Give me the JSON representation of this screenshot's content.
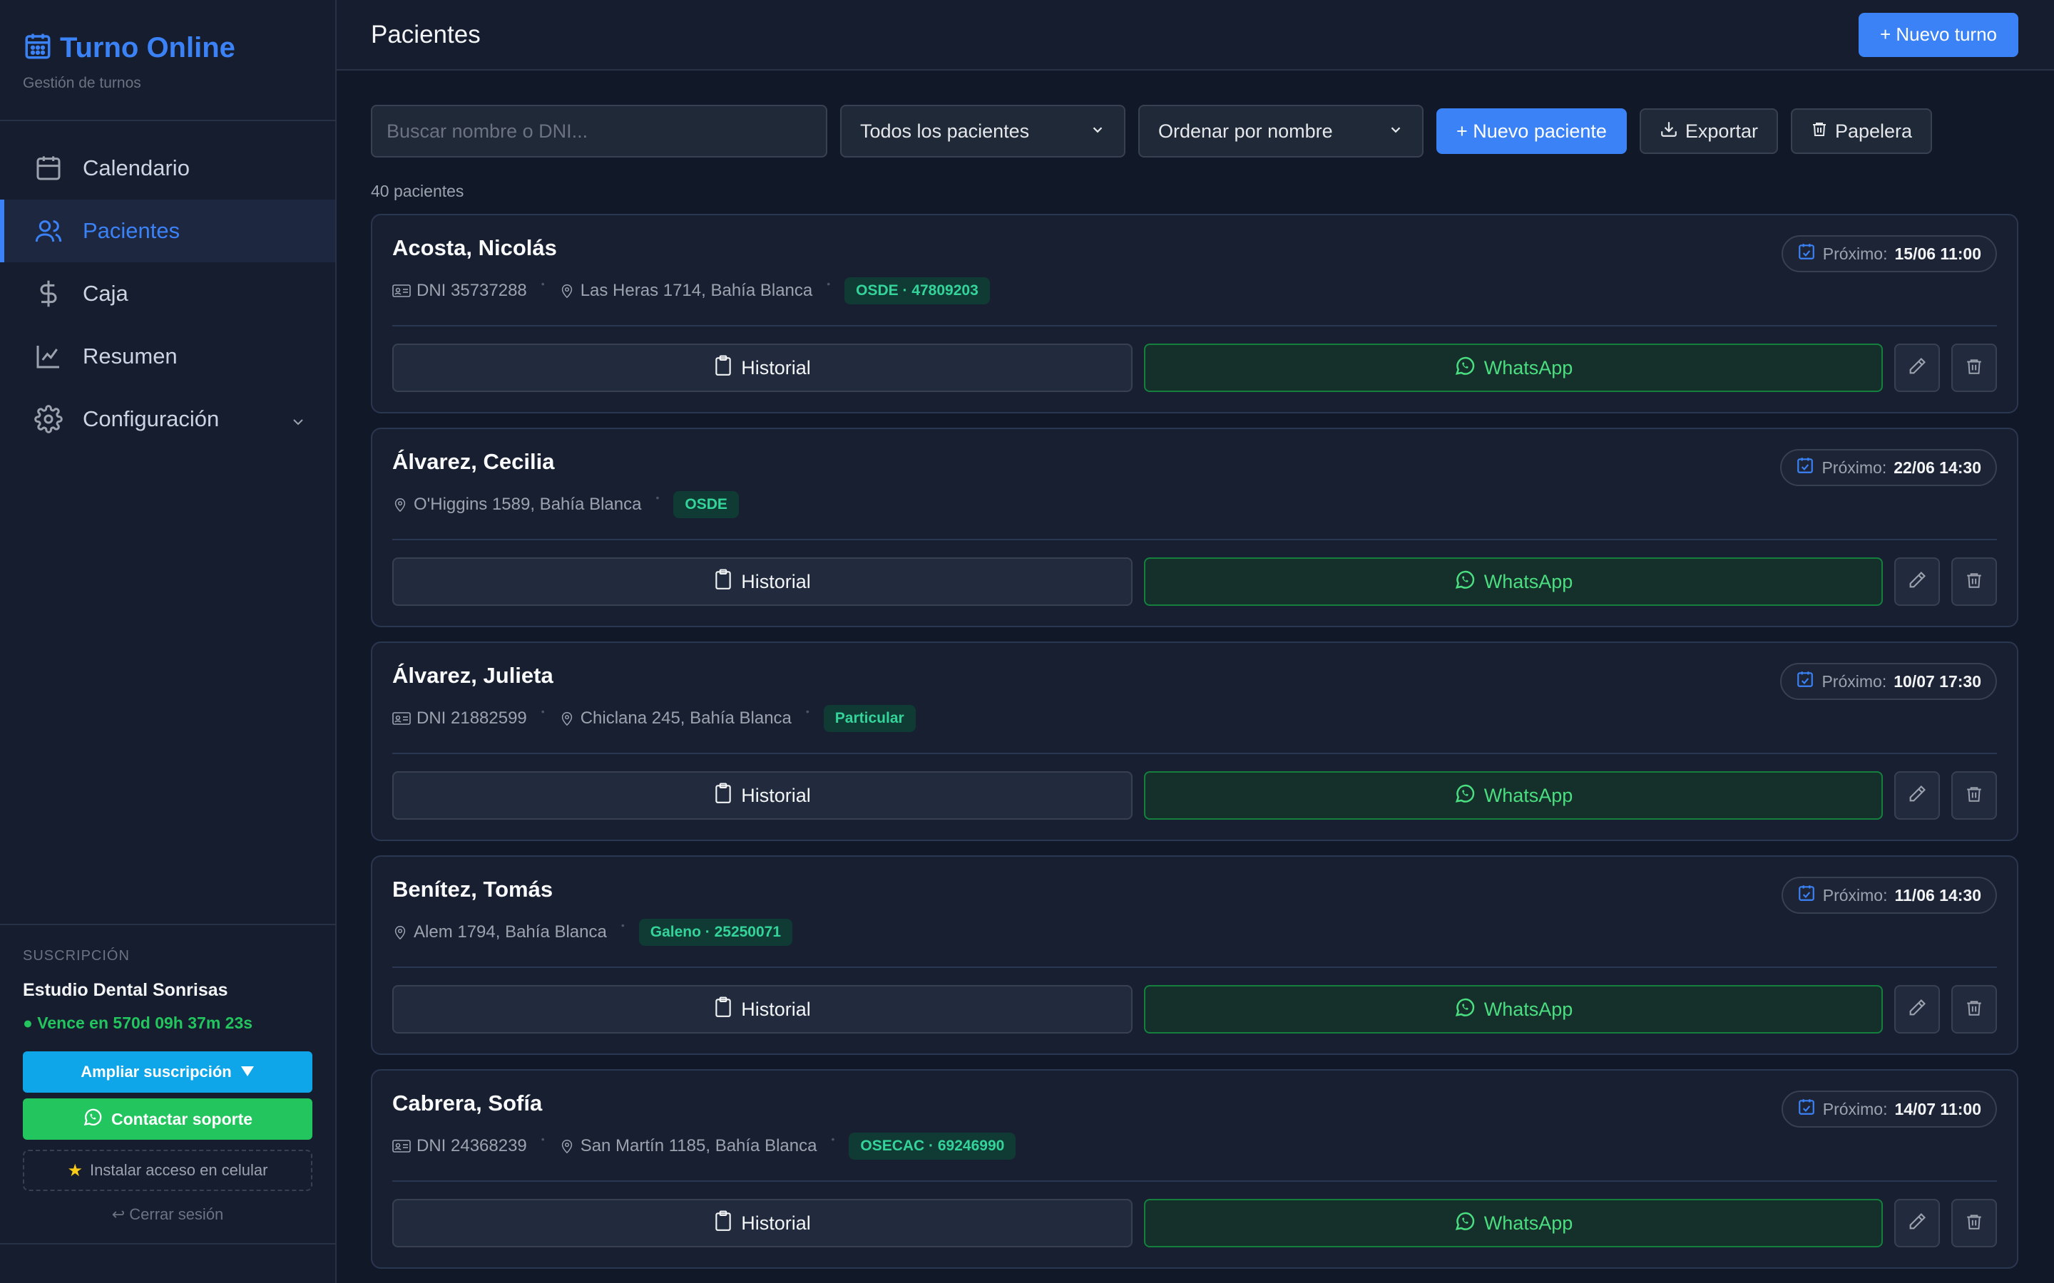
{
  "brand": {
    "title": "Turno Online",
    "subtitle": "Gestión de turnos"
  },
  "nav": [
    {
      "label": "Calendario",
      "icon": "calendar-icon"
    },
    {
      "label": "Pacientes",
      "icon": "users-icon",
      "active": true
    },
    {
      "label": "Caja",
      "icon": "dollar-icon"
    },
    {
      "label": "Resumen",
      "icon": "chart-icon"
    },
    {
      "label": "Configuración",
      "icon": "gear-icon"
    }
  ],
  "subscription": {
    "label": "SUSCRIPCIÓN",
    "name": "Estudio Dental Sonrisas",
    "expires": "● Vence en 570d 09h 37m 23s",
    "upgrade_label": "Ampliar suscripción",
    "support_label": "Contactar soporte",
    "install_label": "Instalar acceso en celular",
    "logout_label": "↩ Cerrar sesión"
  },
  "header": {
    "title": "Pacientes",
    "new_turn_label": "+ Nuevo turno"
  },
  "toolbar": {
    "search_placeholder": "Buscar nombre o DNI...",
    "filter_value": "Todos los pacientes",
    "sort_value": "Ordenar por nombre",
    "new_patient_label": "+ Nuevo paciente",
    "export_label": "Exportar",
    "trash_label": "Papelera"
  },
  "count_label": "40 pacientes",
  "card_labels": {
    "history": "Historial",
    "whatsapp": "WhatsApp",
    "next": "Próximo:"
  },
  "patients": [
    {
      "name": "Acosta, Nicolás",
      "dni": "DNI 35737288",
      "address": "Las Heras 1714, Bahía Blanca",
      "badge": "OSDE · 47809203",
      "next": "15/06 11:00"
    },
    {
      "name": "Álvarez, Cecilia",
      "dni": "",
      "address": "O'Higgins 1589, Bahía Blanca",
      "badge": "OSDE",
      "next": "22/06 14:30"
    },
    {
      "name": "Álvarez, Julieta",
      "dni": "DNI 21882599",
      "address": "Chiclana 245, Bahía Blanca",
      "badge": "Particular",
      "next": "10/07 17:30"
    },
    {
      "name": "Benítez, Tomás",
      "dni": "",
      "address": "Alem 1794, Bahía Blanca",
      "badge": "Galeno · 25250071",
      "next": "11/06 14:30"
    },
    {
      "name": "Cabrera, Sofía",
      "dni": "DNI 24368239",
      "address": "San Martín 1185, Bahía Blanca",
      "badge": "OSECAC · 69246990",
      "next": "14/07 11:00"
    }
  ],
  "colors": {
    "accent": "#3b82f6",
    "success": "#22c55e",
    "badge_text": "#34d399",
    "background": "#111827"
  }
}
